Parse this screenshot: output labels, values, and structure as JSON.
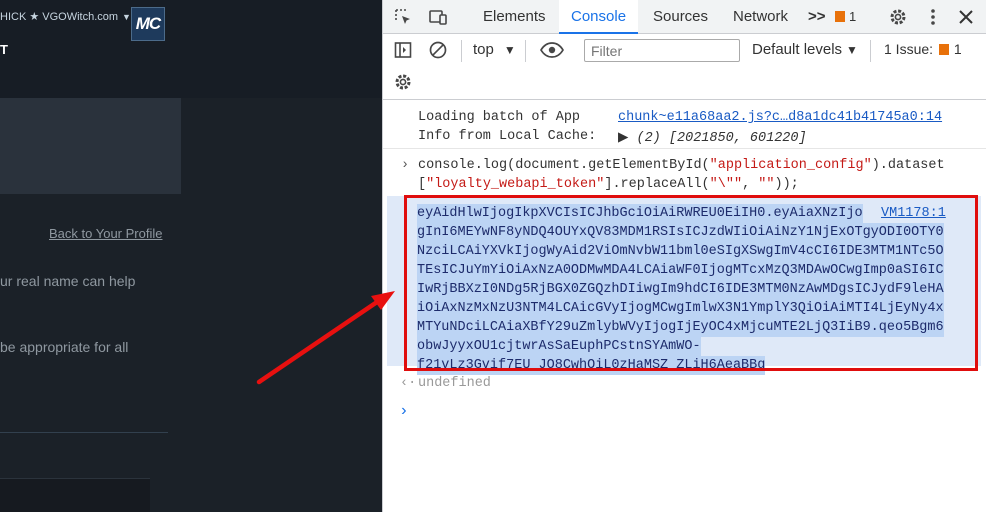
{
  "left": {
    "user_menu": "HICK ★ VGOWitch.com",
    "avatar_text": "MC",
    "nav_letter": "T",
    "back_link": "Back to Your Profile",
    "text_line1": "ur real name can help",
    "text_line2": "be appropriate for all"
  },
  "devtools": {
    "tabs": [
      "Elements",
      "Console",
      "Sources",
      "Network"
    ],
    "more_tabs": ">>",
    "issues_badge_count": "1",
    "context_select": "top",
    "filter_placeholder": "Filter",
    "levels_select": "Default levels",
    "issues_label": "1 Issue:",
    "issues_count": "1",
    "colors": {
      "accent": "#1a73e8",
      "selection": "#bcd4f4",
      "annotation": "#e00d0d",
      "string": "#c41a16"
    }
  },
  "console": {
    "log1_line1": "Loading batch of App",
    "log1_line2": "Info from Local Cache:",
    "log1_source": "chunk~e11a68aa2.js?c…d8a1dc41b41745a0:14",
    "log1_array": "(2) [2021850, 601220]",
    "cmd_prefix": "console.log(document.getElementById(",
    "cmd_string1": "\"application_config\"",
    "cmd_mid1": ").dataset",
    "cmd_line2_open": "[",
    "cmd_string2": "\"loyalty_webapi_token\"",
    "cmd_mid2": "].replaceAll(",
    "cmd_string3": "\"\\\"\"",
    "cmd_comma": ", ",
    "cmd_string4": "\"\"",
    "cmd_end": "));",
    "output_source": "VM1178:1",
    "token_lines": [
      "eyAidHlwIjogIkpXVCIsICJhbGciOiAiRWREU0EiIH0.eyAiaXNzIjo",
      "gInI6MEYwNF8yNDQ4OUYxQV83MDM1RSIsICJzdWIiOiAiNzY1NjExOTgyODI0OTY0",
      "NzciLCAiYXVkIjogWyAid2ViOmNvbW11bml0eSIgXSwgImV4cCI6IDE3MTM1NTc5O",
      "TEsICJuYmYiOiAxNzA0ODMwMDA4LCAiaWF0IjogMTcxMzQ3MDAwOCwgImp0aSI6IC",
      "IwRjBBXzI0NDg5RjBGX0ZGQzhDIiwgIm9hdCI6IDE3MTM0NzAwMDgsICJydF9leHA",
      "iOiAxNzMxNzU3NTM4LCAicGVyIjogMCwgImlwX3N1YmplY3QiOiAiMTI4LjEyNy4x",
      "MTYuNDciLCAiaXBfY29uZmlybWVyIjogIjEyOC4xMjcuMTE2LjQ3IiB9.qeo5Bgm6",
      "obwJyyxOU1cjtwrAsSaEuphPCstnSYAmWO-",
      "f21vLz3Gvif7EU_JO8CwhOiL0zHaMSZ_ZLiH6AeaBBg"
    ],
    "undefined_text": "undefined"
  }
}
